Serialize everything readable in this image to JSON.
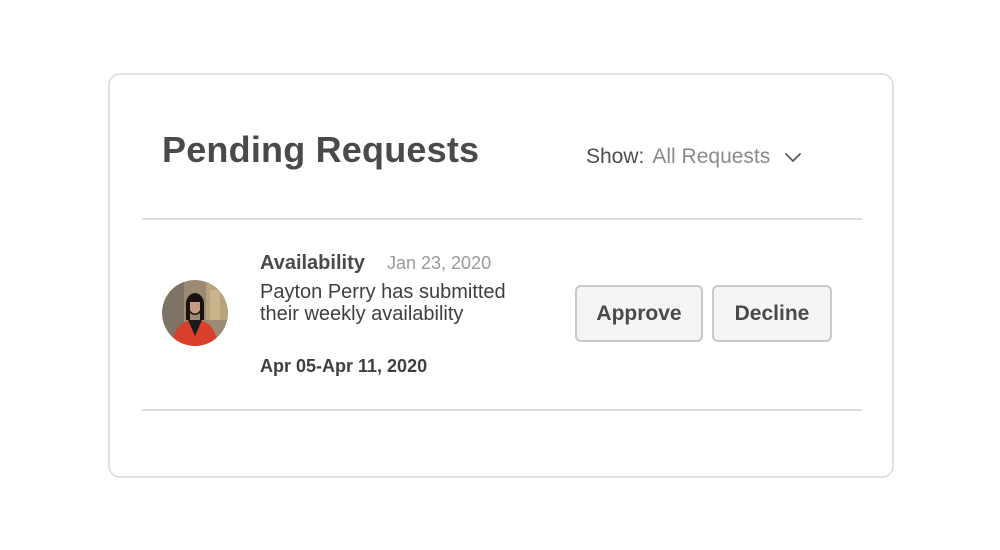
{
  "panel": {
    "title": "Pending Requests",
    "filter": {
      "label": "Show:",
      "selected": "All Requests",
      "icon": "chevron-down-icon"
    }
  },
  "requests": [
    {
      "type": "Availability",
      "date": "Jan 23, 2020",
      "message": "Payton Perry has submitted their weekly availability",
      "date_range": "Apr 05-Apr 11, 2020",
      "avatar": "user-avatar",
      "actions": {
        "approve_label": "Approve",
        "decline_label": "Decline"
      }
    }
  ],
  "colors": {
    "title": "#4a4a4a",
    "muted": "#9a9a9a",
    "border": "#e2e2e2",
    "button_bg": "#f5f5f5",
    "button_border": "#c9c9c9"
  }
}
